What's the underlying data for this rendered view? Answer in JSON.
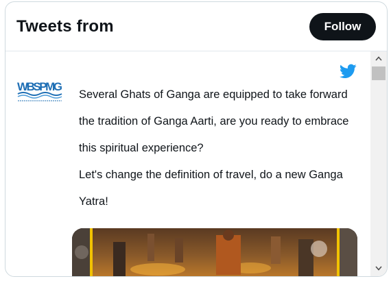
{
  "header": {
    "title": "Tweets from",
    "follow_label": "Follow"
  },
  "tweet": {
    "author_logo_text": "WBSPMG",
    "lines": [
      "Several Ghats of Ganga are equipped to take forward",
      "the tradition of Ganga Aarti, are you ready to embrace",
      "this spiritual experience?",
      "Let's change the definition of travel, do a new Ganga",
      "Yatra!"
    ]
  },
  "icons": {
    "brand": "twitter-bird-icon",
    "scroll_up": "chevron-up-icon",
    "scroll_down": "chevron-down-icon"
  },
  "colors": {
    "follow_bg": "#0f1419",
    "twitter_blue": "#1d9bf0",
    "logo_blue": "#1f6fb5"
  }
}
